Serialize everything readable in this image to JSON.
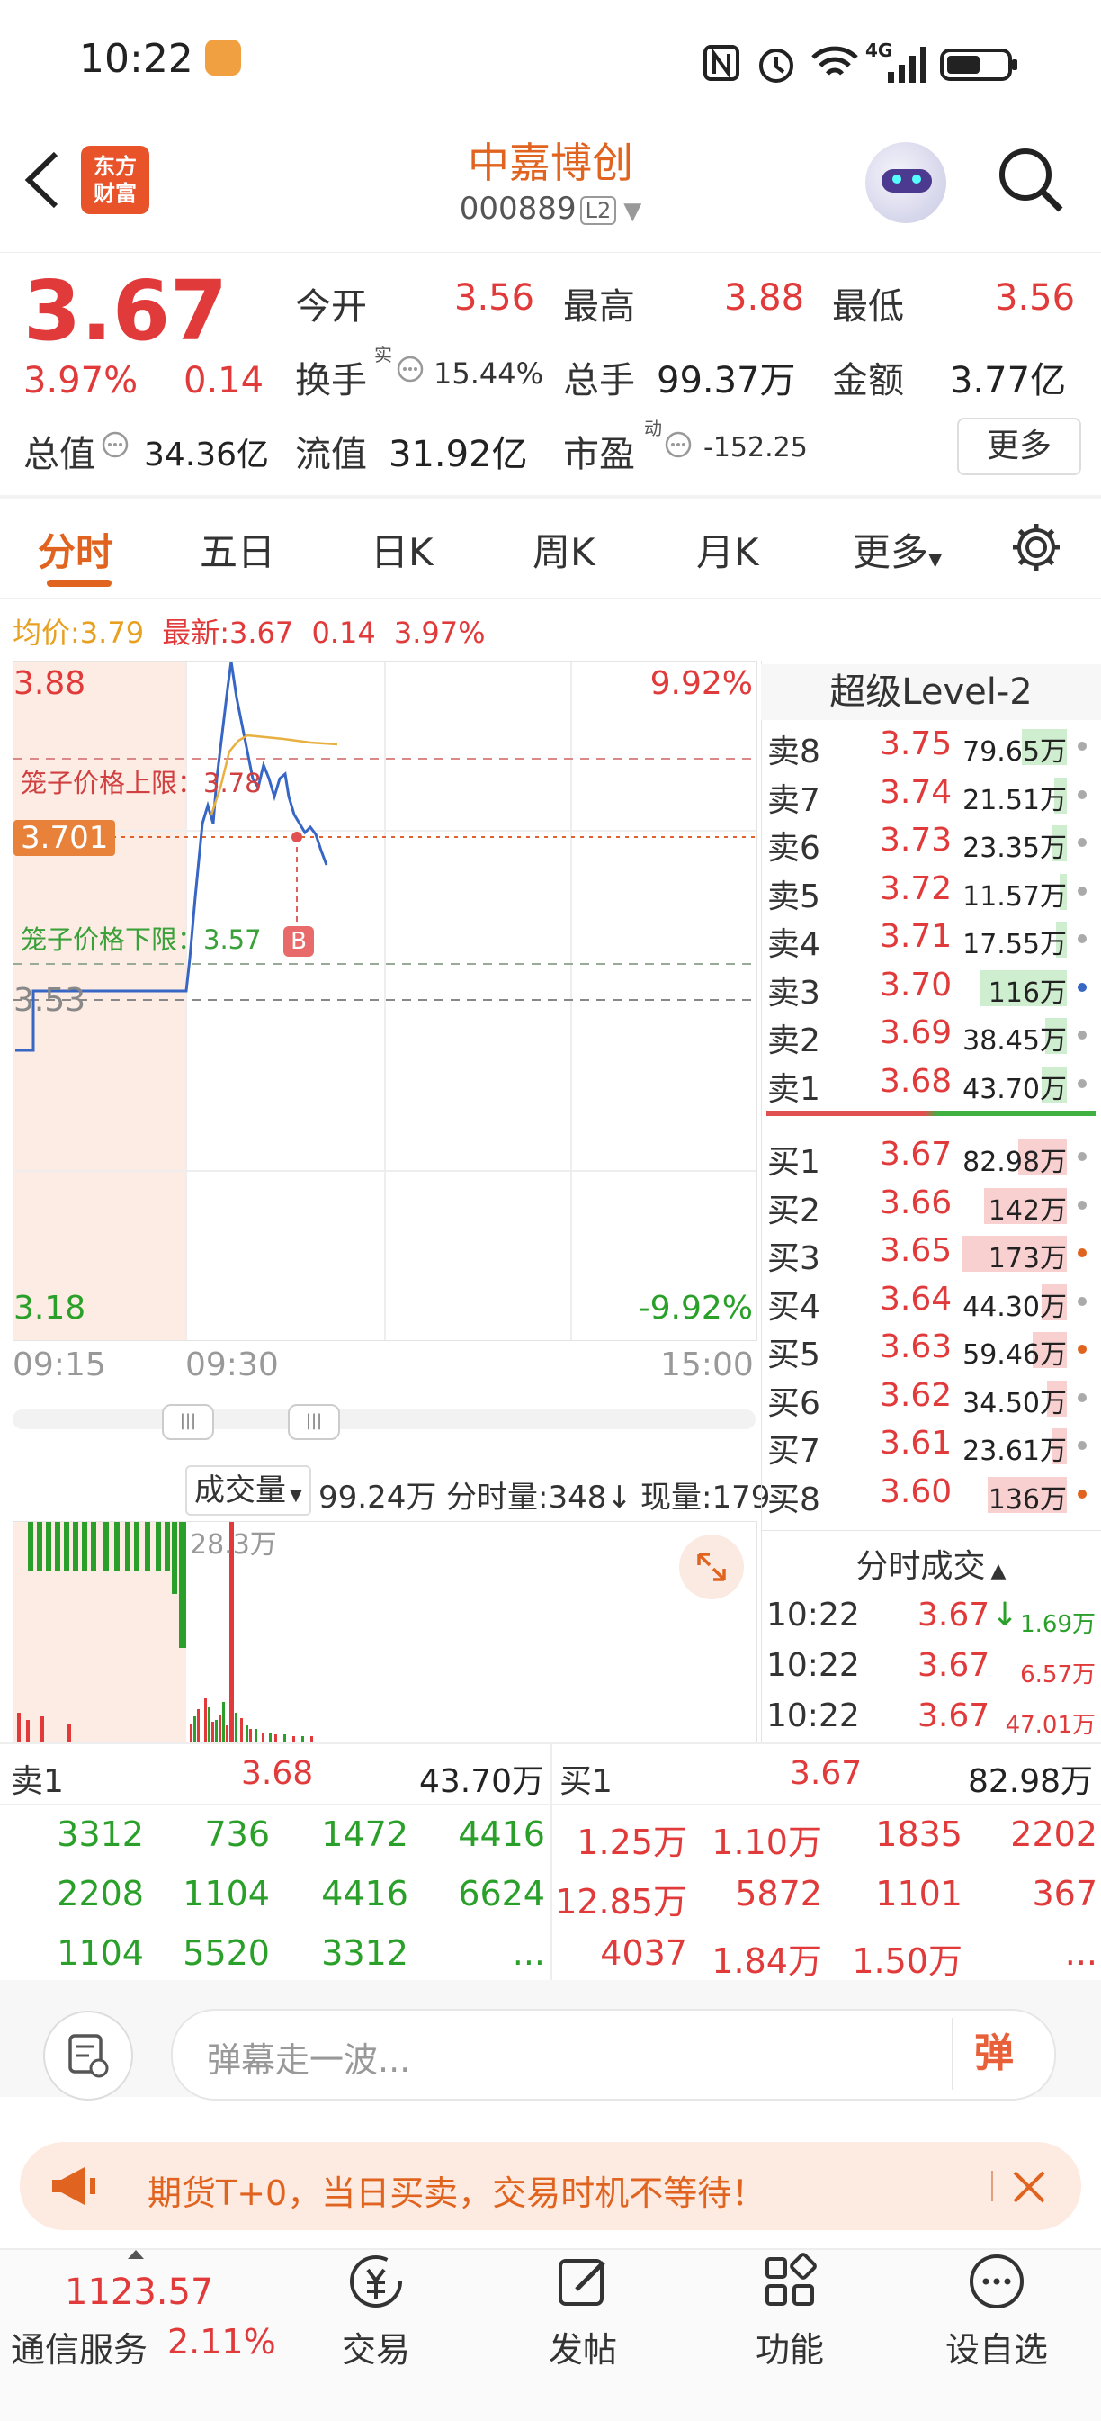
{
  "status_bar": {
    "time": "10:22",
    "network": "4G"
  },
  "header": {
    "title": "中嘉博创",
    "code": "000889",
    "level_badge": "L2",
    "logo_text": "东方\n财富"
  },
  "quote": {
    "price": "3.67",
    "change_pct": "3.97%",
    "change": "0.14",
    "open_label": "今开",
    "open": "3.56",
    "high_label": "最高",
    "high": "3.88",
    "low_label": "最低",
    "low": "3.56",
    "turnover_label": "换手",
    "turnover_sup": "实",
    "turnover": "15.44%",
    "volume_label": "总手",
    "volume": "99.37万",
    "amount_label": "金额",
    "amount": "3.77亿",
    "mktcap_label": "总值",
    "mktcap": "34.36亿",
    "float_label": "流值",
    "float": "31.92亿",
    "pe_label": "市盈",
    "pe_sup": "动",
    "pe": "-152.25",
    "more": "更多"
  },
  "tabs": [
    "分时",
    "五日",
    "日K",
    "周K",
    "月K",
    "更多"
  ],
  "avg_line": {
    "avg_label": "均价:",
    "avg": "3.79",
    "latest_label": "最新:",
    "latest": "3.67",
    "chg": "0.14",
    "pct": "3.97%"
  },
  "chart": {
    "y_top": "3.88",
    "y_bottom": "3.18",
    "pct_top": "9.92%",
    "pct_bottom": "-9.92%",
    "prev_close_label": "3.53",
    "cage_upper": "笼子价格上限：3.78",
    "cage_lower": "笼子价格下限：3.57",
    "cursor_price": "3.701",
    "b_marker": "B",
    "x_labels": [
      "09:15",
      "09:30",
      "15:00"
    ],
    "vol_selector": "成交量",
    "vol_total": "99.24万",
    "vol_tick": "分时量:348",
    "vol_now": "现量:179",
    "vol_peak": "28.3万"
  },
  "orderbook": {
    "title": "超级Level-2",
    "asks": [
      {
        "label": "卖8",
        "price": "3.75",
        "vol": "79.65万",
        "fill": 0.25
      },
      {
        "label": "卖7",
        "price": "3.74",
        "vol": "21.51万",
        "fill": 0.07
      },
      {
        "label": "卖6",
        "price": "3.73",
        "vol": "23.35万",
        "fill": 0.08
      },
      {
        "label": "卖5",
        "price": "3.72",
        "vol": "11.57万",
        "fill": 0.04
      },
      {
        "label": "卖4",
        "price": "3.71",
        "vol": "17.55万",
        "fill": 0.06
      },
      {
        "label": "卖3",
        "price": "3.70",
        "vol": "116万",
        "fill": 0.48
      },
      {
        "label": "卖2",
        "price": "3.69",
        "vol": "38.45万",
        "fill": 0.12
      },
      {
        "label": "卖1",
        "price": "3.68",
        "vol": "43.70万",
        "fill": 0.14
      }
    ],
    "bids": [
      {
        "label": "买1",
        "price": "3.67",
        "vol": "82.98万",
        "fill": 0.27
      },
      {
        "label": "买2",
        "price": "3.66",
        "vol": "142万",
        "fill": 0.46
      },
      {
        "label": "买3",
        "price": "3.65",
        "vol": "173万",
        "fill": 0.58
      },
      {
        "label": "买4",
        "price": "3.64",
        "vol": "44.30万",
        "fill": 0.14
      },
      {
        "label": "买5",
        "price": "3.63",
        "vol": "59.46万",
        "fill": 0.19
      },
      {
        "label": "买6",
        "price": "3.62",
        "vol": "34.50万",
        "fill": 0.11
      },
      {
        "label": "买7",
        "price": "3.61",
        "vol": "23.61万",
        "fill": 0.08
      },
      {
        "label": "买8",
        "price": "3.60",
        "vol": "136万",
        "fill": 0.44
      }
    ],
    "ticks_title": "分时成交",
    "ticks": [
      {
        "time": "10:22",
        "price": "3.67",
        "arrow": "↓",
        "vol": "1.69万"
      },
      {
        "time": "10:22",
        "price": "3.67",
        "arrow": "",
        "vol": "6.57万"
      },
      {
        "time": "10:22",
        "price": "3.67",
        "arrow": "",
        "vol": "47.01万"
      }
    ]
  },
  "trade_summary": {
    "sell_label": "卖1",
    "sell_price": "3.68",
    "sell_vol": "43.70万",
    "buy_label": "买1",
    "buy_price": "3.67",
    "buy_vol": "82.98万",
    "sell_rows": [
      [
        "3312",
        "736",
        "1472",
        "4416"
      ],
      [
        "2208",
        "1104",
        "4416",
        "6624"
      ],
      [
        "1104",
        "5520",
        "3312",
        "..."
      ]
    ],
    "buy_rows": [
      [
        "1.25万",
        "1.10万",
        "1835",
        "2202"
      ],
      [
        "12.85万",
        "5872",
        "1101",
        "367"
      ],
      [
        "4037",
        "1.84万",
        "1.50万",
        "..."
      ]
    ]
  },
  "comment_bar": {
    "placeholder": "弹幕走一波...",
    "danmu_btn": "弹"
  },
  "promo": {
    "text": "期货T+0，当日买卖，交易时机不等待！"
  },
  "bottom_nav": {
    "index_value": "1123.57",
    "index_name": "通信服务",
    "index_pct": "2.11%",
    "items": [
      "交易",
      "发帖",
      "功能",
      "设自选"
    ]
  },
  "colors": {
    "up": "#e03a3a",
    "down": "#2aa02a",
    "accent": "#e0641f"
  }
}
